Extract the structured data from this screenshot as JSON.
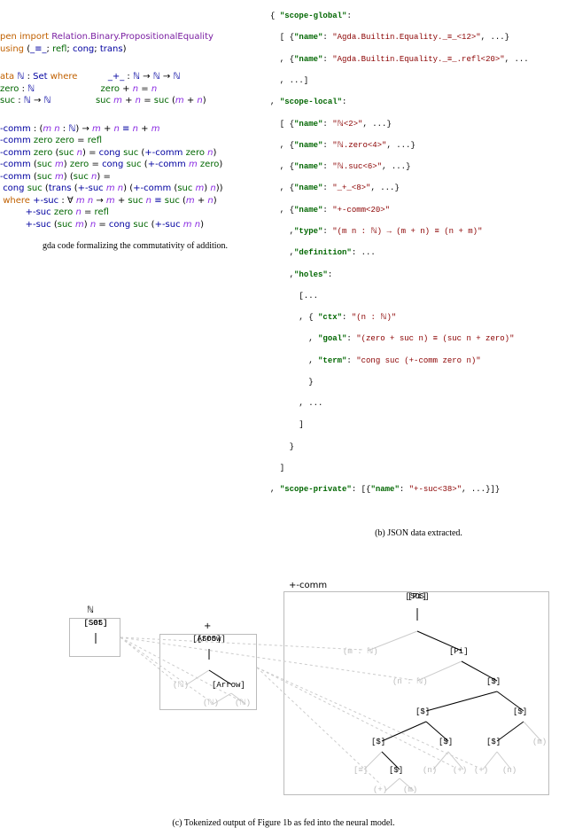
{
  "agda": {
    "import1a": "pen import",
    "import1b": "Relation.Binary.PropositionalEquality",
    "using": "using (_≡_; refl; cong; trans)",
    "data_kw": "ata",
    "nat": "ℕ",
    "set": "Set",
    "where": "where",
    "zero": "zero",
    "suc": "suc",
    "plusty": "_+_ : ℕ → ℕ → ℕ",
    "pluszero": "zero  + n = n",
    "plussuc": "suc m + n = suc (m + n)",
    "comm_sig_pre": "-comm : (",
    "comm_mn": "m n",
    "comm_sig_mid": " : ℕ) →",
    "comm_sig_rhs": "m + n ≡ n + m",
    "comm1": "-comm zero    zero    = refl",
    "comm2a": "-comm zero    (suc ",
    "comm2b": "n",
    "comm2c": ") = cong suc (+-comm zero ",
    "comm2d": "n",
    "comm2e": ")",
    "comm3": "-comm (suc m) zero    = cong suc (+-comm m zero)",
    "comm4": "-comm (suc m) (suc n) =",
    "comm5": "cong suc (trans (+-suc m n) (+-comm (suc m) n))",
    "wherecl": "where +-suc : ∀ m n → m + suc n ≡ suc (m + n)",
    "where1": "+-suc zero    n = refl",
    "where2": "+-suc (suc m) n = cong suc (+-suc m n)"
  },
  "caption_a": "gda code formalizing the commutativity of addition.",
  "caption_b": "(b) JSON data extracted.",
  "caption_c": "(c) Tokenized output of Figure 1b as fed into the neural model.",
  "json": {
    "l1": "{ \"scope-global\":",
    "l2": "  [ {\"name\": \"Agda.Builtin.Equality._≡_<12>\", ...}",
    "l3": "  , {\"name\": \"Agda.Builtin.Equality._≡_.refl<20>\", ...",
    "l4": "  , ...]",
    "l5": ", \"scope-local\":",
    "l6": "  [ {\"name\": \"ℕ<2>\", ...}",
    "l7": "  , {\"name\": \"ℕ.zero<4>\", ...}",
    "l8": "  , {\"name\": \"ℕ.suc<6>\", ...}",
    "l9": "  , {\"name\": \"_+_<8>\", ...}",
    "l10": "  , {\"name\": \"+-comm<20>\"",
    "l11": "    ,\"type\": \"(m n : ℕ) → (m + n) ≡ (n + m)\"",
    "l12": "    ,\"definition\": ...",
    "l13": "    ,\"holes\":",
    "l14": "      [...",
    "l15": "      , { \"ctx\": \"(n : ℕ)\"",
    "l16": "        , \"goal\": \"(zero + suc n) ≡ (suc n + zero)\"",
    "l17": "        , \"term\": \"cong suc (+-comm zero n)\"",
    "l18": "        }",
    "l19": "      , ...",
    "l20": "      ]",
    "l21": "    }",
    "l22": "  ]",
    "l23": ", \"scope-private\": [{\"name\": \"+-suc<38>\", ...}]}"
  },
  "tree": {
    "nat_title": "ℕ",
    "plus_title": "+",
    "comm_title": "+-comm",
    "sos": "[SOS]",
    "set": "[Set]",
    "arrow": "[Arrow]",
    "pi": "[Pi]",
    "dollar": "[$]",
    "eq": "[≡]",
    "nat": "(ℕ)",
    "mN": "(m : ℕ)",
    "nN": "(n : ℕ)",
    "plus": "(+)",
    "m": "(m)",
    "n": "(n)"
  }
}
